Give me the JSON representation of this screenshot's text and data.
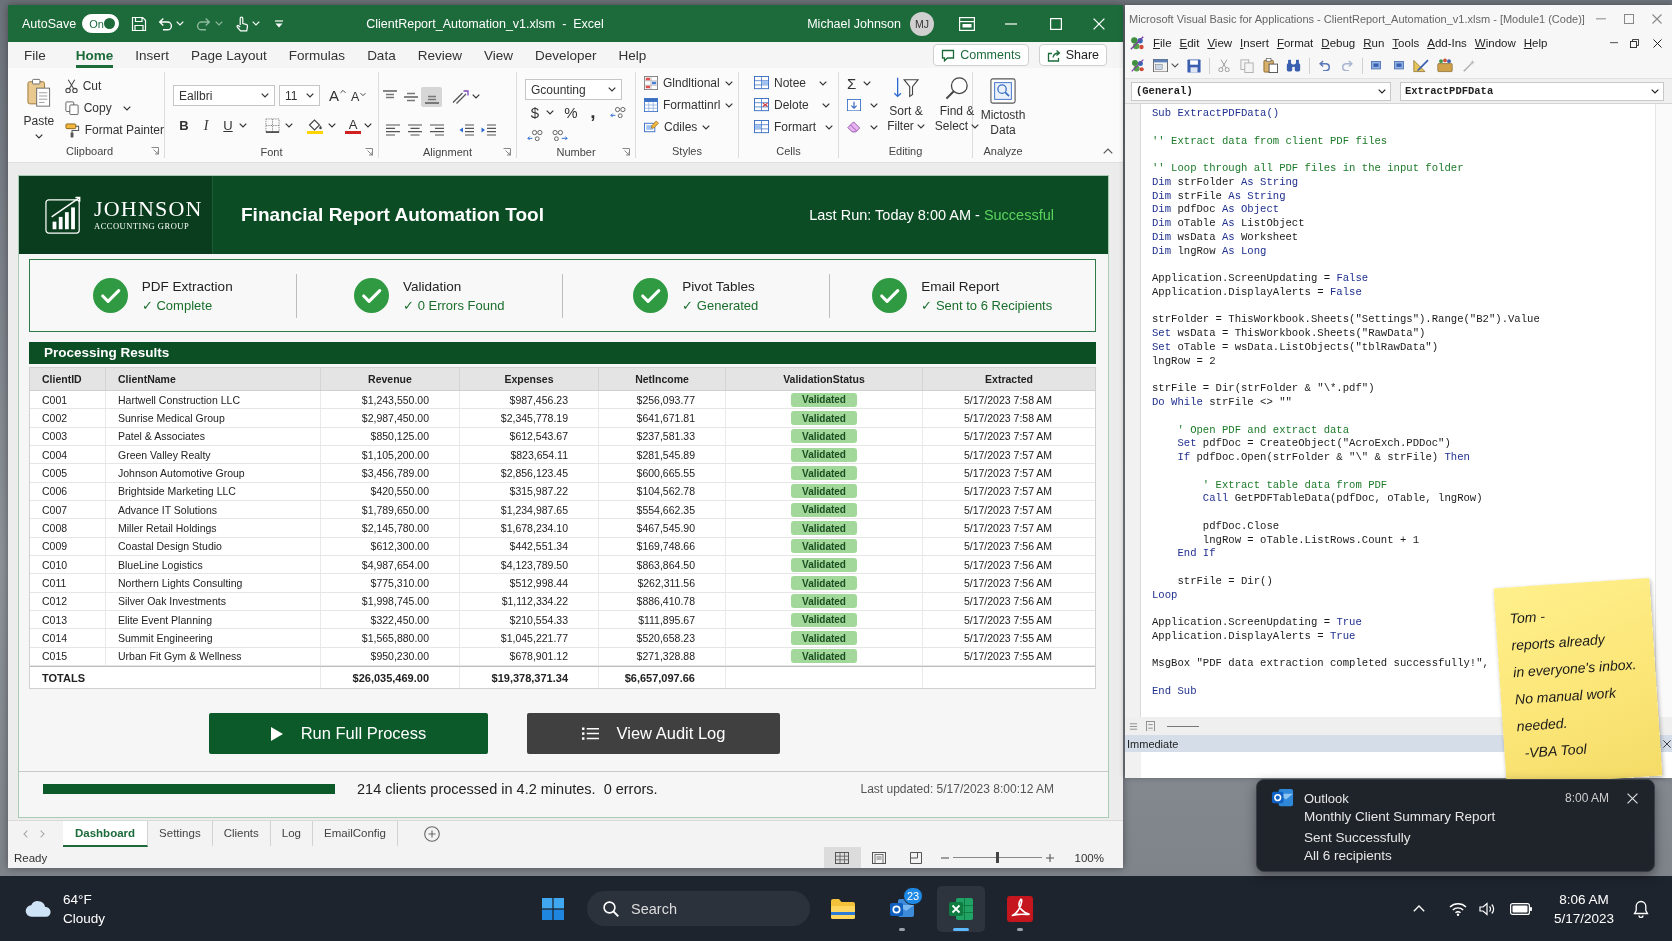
{
  "excel_window": {
    "title_bar": {
      "autosave_label": "AutoSave",
      "autosave_toggle": {
        "label": "On",
        "on": true
      },
      "title": "ClientReport_Automation_v1.xlsm  -  Excel",
      "user_name": "Michael Johnson",
      "avatar_initials": "MJ"
    },
    "ribbon_tabs": [
      {
        "label": "File",
        "selected": false
      },
      {
        "label": "Home",
        "selected": true
      },
      {
        "label": "Insert",
        "selected": false
      },
      {
        "label": "Page Layout",
        "selected": false
      },
      {
        "label": "Formulas",
        "selected": false
      },
      {
        "label": "Data",
        "selected": false
      },
      {
        "label": "Review",
        "selected": false
      },
      {
        "label": "View",
        "selected": false
      },
      {
        "label": "Developer",
        "selected": false
      },
      {
        "label": "Help",
        "selected": false
      }
    ],
    "comments_button": "Comments",
    "share_button": "Share",
    "ribbon": {
      "clipboard": {
        "label": "Clipboard",
        "paste": "Paste",
        "cut": "Cut",
        "copy": "Copy",
        "format_painter": "Format Painter"
      },
      "font": {
        "label": "Font",
        "font_name": "Eallbri",
        "font_size": "11",
        "grow_font": "A",
        "shrink_font": "A",
        "bold": "B",
        "italic": "I",
        "underline": "U",
        "font_color": "A"
      },
      "alignment": {
        "label": "Alignment",
        "vertical_align": [
          {
            "selected": false
          },
          {
            "selected": false
          },
          {
            "selected": true
          }
        ]
      },
      "number": {
        "label": "Number",
        "format": "Gcounting",
        "currency": "$",
        "percent": "%",
        "comma_style": ","
      },
      "styles": {
        "label": "Styles",
        "conditional_formatting": "Glndltional",
        "format_as_table": "Formattinrl",
        "cell_styles": "Cdiles"
      },
      "cells": {
        "label": "Cells",
        "insert": "Notee",
        "delete": "Delote",
        "format": "Formart"
      },
      "editing": {
        "label": "Editing",
        "autosum": "Σ",
        "sort_filter": "Sort & Filter",
        "find_select": "Find & Select"
      },
      "analyze": {
        "label": "Analyze",
        "analyze_data": "Mictosth Data"
      }
    },
    "dashboard": {
      "logo": {
        "name": "JOHNSON",
        "tagline": "ACCOUNTING GROUP"
      },
      "title": "Financial Report Automation Tool",
      "last_run": {
        "label": "Last Run: Today 8:00 AM -",
        "status": "Successful"
      },
      "steps": [
        {
          "title": "PDF Extraction",
          "status": "✓ Complete",
          "done": true
        },
        {
          "title": "Validation",
          "status": "✓ 0 Errors Found",
          "done": true
        },
        {
          "title": "Pivot Tables",
          "status": "✓ Generated",
          "done": true
        },
        {
          "title": "Email Report",
          "status": "✓ Sent to 6 Recipients",
          "done": true
        }
      ],
      "results": {
        "title": "Processing Results",
        "columns": [
          {
            "label": "ClientID",
            "kind": "text"
          },
          {
            "label": "ClientName",
            "kind": "text"
          },
          {
            "label": "Revenue",
            "kind": "money"
          },
          {
            "label": "Expenses",
            "kind": "money"
          },
          {
            "label": "NetIncome",
            "kind": "money"
          },
          {
            "label": "ValidationStatus",
            "kind": "badge"
          },
          {
            "label": "Extracted",
            "kind": "date"
          }
        ],
        "rows": [
          [
            "C001",
            "Hartwell Construction LLC",
            "$1,243,550.00",
            "$987,456.23",
            "$256,093.77",
            "Validated",
            "5/17/2023 7:58 AM"
          ],
          [
            "C002",
            "Sunrise Medical Group",
            "$2,987,450.00",
            "$2,345,778.19",
            "$641,671.81",
            "Validated",
            "5/17/2023 7:58 AM"
          ],
          [
            "C003",
            "Patel & Associates",
            "$850,125.00",
            "$612,543.67",
            "$237,581.33",
            "Validated",
            "5/17/2023 7:57 AM"
          ],
          [
            "C004",
            "Green Valley Realty",
            "$1,105,200.00",
            "$823,654.11",
            "$281,545.89",
            "Validated",
            "5/17/2023 7:57 AM"
          ],
          [
            "C005",
            "Johnson Automotive Group",
            "$3,456,789.00",
            "$2,856,123.45",
            "$600,665.55",
            "Validated",
            "5/17/2023 7:57 AM"
          ],
          [
            "C006",
            "Brightside Marketing LLC",
            "$420,550.00",
            "$315,987.22",
            "$104,562.78",
            "Validated",
            "5/17/2023 7:57 AM"
          ],
          [
            "C007",
            "Advance IT Solutions",
            "$1,789,650.00",
            "$1,234,987.65",
            "$554,662.35",
            "Validated",
            "5/17/2023 7:57 AM"
          ],
          [
            "C008",
            "Miller Retail Holdings",
            "$2,145,780.00",
            "$1,678,234.10",
            "$467,545.90",
            "Validated",
            "5/17/2023 7:57 AM"
          ],
          [
            "C009",
            "Coastal Design Studio",
            "$612,300.00",
            "$442,551.34",
            "$169,748.66",
            "Validated",
            "5/17/2023 7:56 AM"
          ],
          [
            "C010",
            "BlueLine Logistics",
            "$4,987,654.00",
            "$4,123,789.50",
            "$863,864.50",
            "Validated",
            "5/17/2023 7:56 AM"
          ],
          [
            "C011",
            "Northern Lights Consulting",
            "$775,310.00",
            "$512,998.44",
            "$262,311.56",
            "Validated",
            "5/17/2023 7:56 AM"
          ],
          [
            "C012",
            "Silver Oak Investments",
            "$1,998,745.00",
            "$1,112,334.22",
            "$886,410.78",
            "Validated",
            "5/17/2023 7:56 AM"
          ],
          [
            "C013",
            "Elite Event Planning",
            "$322,450.00",
            "$210,554.33",
            "$111,895.67",
            "Validated",
            "5/17/2023 7:55 AM"
          ],
          [
            "C014",
            "Summit Engineering",
            "$1,565,880.00",
            "$1,045,221.77",
            "$520,658.23",
            "Validated",
            "5/17/2023 7:55 AM"
          ],
          [
            "C015",
            "Urban Fit Gym & Wellness",
            "$950,230.00",
            "$678,901.12",
            "$271,328.88",
            "Validated",
            "5/17/2023 7:55 AM"
          ]
        ],
        "totals": {
          "label": "TOTALS",
          "values": [
            "$26,035,469.00",
            "$19,378,371.34",
            "$6,657,097.66"
          ]
        }
      },
      "run_button": "Run Full Process",
      "audit_button": "View Audit Log",
      "progress": {
        "level": 1,
        "summary": "214 clients processed in 4.2 minutes.  0 errors.",
        "last_updated": "Last updated: 5/17/2023 8:00:12 AM"
      }
    },
    "sheet_tabs": [
      {
        "label": "Dashboard",
        "selected": true
      },
      {
        "label": "Settings",
        "selected": false
      },
      {
        "label": "Clients",
        "selected": false
      },
      {
        "label": "Log",
        "selected": false
      },
      {
        "label": "EmailConfig",
        "selected": false
      }
    ],
    "status_bar": {
      "status": "Ready",
      "views": [
        {
          "selected": true
        },
        {
          "selected": false
        },
        {
          "selected": false
        }
      ],
      "zoom_slider": {
        "level": 0.5
      },
      "zoom": "100%"
    }
  },
  "vba_window": {
    "title": "Microsoft Visual Basic for Applications - ClientReport_Automation_v1.xlsm - [Module1 (Code)]",
    "menu": [
      "File",
      "Edit",
      "View",
      "Insert",
      "Format",
      "Debug",
      "Run",
      "Tools",
      "Add-Ins",
      "Window",
      "Help"
    ],
    "object_box": "(General)",
    "procedure_box": "ExtractPDFData",
    "code_blocks": [
      [
        [
          {
            "kind": "keyword",
            "text": "Sub ExtractPDFData()"
          }
        ]
      ],
      [
        [
          {
            "kind": "comment",
            "text": "'' Extract data from client PDF files"
          }
        ]
      ],
      [
        [
          {
            "kind": "comment",
            "text": "'' Loop through all PDF files in the input folder"
          }
        ],
        [
          {
            "kind": "keyword",
            "text": "Dim"
          },
          {
            "kind": "plain",
            "text": " strFolder "
          },
          {
            "kind": "keyword",
            "text": "As String"
          }
        ],
        [
          {
            "kind": "keyword",
            "text": "Dim"
          },
          {
            "kind": "plain",
            "text": " strFile "
          },
          {
            "kind": "keyword",
            "text": "As String"
          }
        ],
        [
          {
            "kind": "keyword",
            "text": "Dim"
          },
          {
            "kind": "plain",
            "text": " pdfDoc "
          },
          {
            "kind": "keyword",
            "text": "As Object"
          }
        ],
        [
          {
            "kind": "keyword",
            "text": "Dim"
          },
          {
            "kind": "plain",
            "text": " oTable "
          },
          {
            "kind": "keyword",
            "text": "As"
          },
          {
            "kind": "plain",
            "text": " ListObject"
          }
        ],
        [
          {
            "kind": "keyword",
            "text": "Dim"
          },
          {
            "kind": "plain",
            "text": " wsData "
          },
          {
            "kind": "keyword",
            "text": "As"
          },
          {
            "kind": "plain",
            "text": " Worksheet"
          }
        ],
        [
          {
            "kind": "keyword",
            "text": "Dim"
          },
          {
            "kind": "plain",
            "text": " lngRow "
          },
          {
            "kind": "keyword",
            "text": "As Long"
          }
        ]
      ],
      [
        [
          {
            "kind": "plain",
            "text": "Application.ScreenUpdating = "
          },
          {
            "kind": "keyword",
            "text": "False"
          }
        ],
        [
          {
            "kind": "plain",
            "text": "Application.DisplayAlerts = "
          },
          {
            "kind": "keyword",
            "text": "False"
          }
        ]
      ],
      [
        [
          {
            "kind": "plain",
            "text": "strFolder = ThisWorkbook.Sheets(\"Settings\").Range(\"B2\").Value"
          }
        ],
        [
          {
            "kind": "keyword",
            "text": "Set"
          },
          {
            "kind": "plain",
            "text": " wsData = ThisWorkbook.Sheets(\"RawData\")"
          }
        ],
        [
          {
            "kind": "keyword",
            "text": "Set"
          },
          {
            "kind": "plain",
            "text": " oTable = wsData.ListObjects(\"tblRawData\")"
          }
        ],
        [
          {
            "kind": "plain",
            "text": "lngRow = 2"
          }
        ]
      ],
      [
        [
          {
            "kind": "plain",
            "text": "strFile = Dir(strFolder & \"\\*.pdf\")"
          }
        ],
        [
          {
            "kind": "keyword",
            "text": "Do While"
          },
          {
            "kind": "plain",
            "text": " strFile <> \"\""
          }
        ]
      ],
      [
        [
          {
            "kind": "comment",
            "text": "    ' Open PDF and extract data"
          }
        ],
        [
          {
            "kind": "keyword",
            "text": "    Set"
          },
          {
            "kind": "plain",
            "text": " pdfDoc = CreateObject(\"AcroExch.PDDoc\")"
          }
        ],
        [
          {
            "kind": "keyword",
            "text": "    If"
          },
          {
            "kind": "plain",
            "text": " pdfDoc.Open(strFolder & \"\\\" & strFile) "
          },
          {
            "kind": "keyword",
            "text": "Then"
          }
        ]
      ],
      [
        [
          {
            "kind": "comment",
            "text": "        ' Extract table data from PDF"
          }
        ],
        [
          {
            "kind": "keyword",
            "text": "        Call"
          },
          {
            "kind": "plain",
            "text": " GetPDFTableData(pdfDoc, oTable, lngRow)"
          }
        ]
      ],
      [
        [
          {
            "kind": "plain",
            "text": "        pdfDoc.Close"
          }
        ],
        [
          {
            "kind": "plain",
            "text": "        lngRow = oTable.ListRows.Count + 1"
          }
        ],
        [
          {
            "kind": "keyword",
            "text": "    End If"
          }
        ]
      ],
      [
        [
          {
            "kind": "plain",
            "text": "    strFile = Dir()"
          }
        ],
        [
          {
            "kind": "keyword",
            "text": "Loop"
          }
        ]
      ],
      [
        [
          {
            "kind": "plain",
            "text": "Application.ScreenUpdating = "
          },
          {
            "kind": "keyword",
            "text": "True"
          }
        ],
        [
          {
            "kind": "plain",
            "text": "Application.DisplayAlerts = "
          },
          {
            "kind": "keyword",
            "text": "True"
          }
        ]
      ],
      [
        [
          {
            "kind": "plain",
            "text": "MsgBox \"PDF data extraction completed successfully!\","
          }
        ]
      ],
      [
        [
          {
            "kind": "keyword",
            "text": "End Sub"
          }
        ]
      ]
    ],
    "immediate_title": "Immediate"
  },
  "sticky_note": {
    "message": "Tom -\nreports already\nin everyone's inbox.\nNo manual work\nneeded.",
    "signature": "-VBA Tool"
  },
  "notification": {
    "app": "Outlook",
    "time": "8:00 AM",
    "title": "Monthly Client Summary Report",
    "lines": [
      "Sent Successfully",
      "All 6 recipients"
    ]
  },
  "taskbar": {
    "weather": {
      "temperature": "64°F",
      "condition": "Cloudy"
    },
    "search": {
      "placeholder": "Search"
    },
    "apps": [
      {
        "kind": "file_explorer",
        "running": false,
        "selected": false
      },
      {
        "kind": "mail",
        "badge": "23",
        "running": true,
        "selected": false
      },
      {
        "kind": "spreadsheet",
        "running": true,
        "selected": true
      },
      {
        "kind": "pdf_reader",
        "running": true,
        "selected": false
      }
    ],
    "clock": {
      "time": "8:06 AM",
      "date": "5/17/2023"
    }
  }
}
